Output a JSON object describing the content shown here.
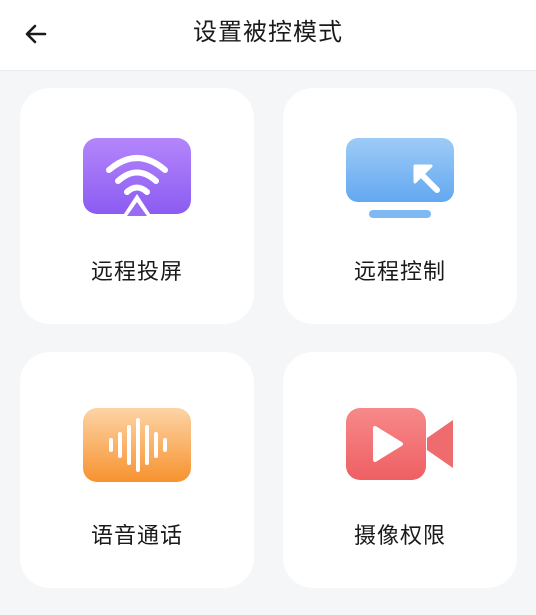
{
  "header": {
    "title": "设置被控模式",
    "back_icon": "arrow-left-icon"
  },
  "cards": [
    {
      "label": "远程投屏",
      "icon": "screen-cast-icon",
      "color": "#9a6cf6"
    },
    {
      "label": "远程控制",
      "icon": "remote-control-icon",
      "color": "#6fb2f3"
    },
    {
      "label": "语音通话",
      "icon": "voice-wave-icon",
      "color": "#f79a4e"
    },
    {
      "label": "摄像权限",
      "icon": "video-camera-icon",
      "color": "#f06a6a"
    }
  ]
}
